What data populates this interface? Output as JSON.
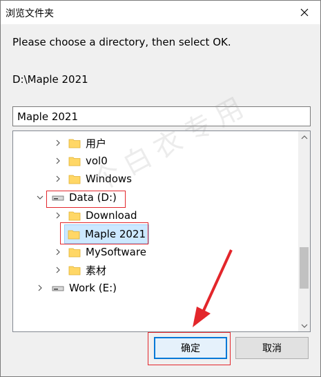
{
  "window": {
    "title": "浏览文件夹"
  },
  "dialog": {
    "prompt": "Please choose a directory, then select OK.",
    "current_path": "D:\\Maple 2021",
    "folder_name_value": "Maple 2021"
  },
  "tree": {
    "items": [
      {
        "label": "用户",
        "type": "folder",
        "level": 2,
        "expanded": false
      },
      {
        "label": "vol0",
        "type": "folder",
        "level": 2,
        "expanded": false
      },
      {
        "label": "Windows",
        "type": "folder",
        "level": 2,
        "expanded": false
      },
      {
        "label": "Data (D:)",
        "type": "drive",
        "level": 1,
        "expanded": true
      },
      {
        "label": "Download",
        "type": "folder",
        "level": 2,
        "expanded": false
      },
      {
        "label": "Maple 2021",
        "type": "folder",
        "level": 2,
        "expanded": false,
        "selected": true
      },
      {
        "label": "MySoftware",
        "type": "folder",
        "level": 2,
        "expanded": false
      },
      {
        "label": "素材",
        "type": "folder",
        "level": 2,
        "expanded": false
      },
      {
        "label": "Work (E:)",
        "type": "drive",
        "level": 1,
        "expanded": false
      }
    ]
  },
  "buttons": {
    "ok_label": "确定",
    "cancel_label": "取消"
  },
  "watermark": {
    "text": "个白衣专用"
  },
  "colors": {
    "selection": "#cce8ff",
    "accent": "#0078d7",
    "annotation": "#e3262b"
  }
}
